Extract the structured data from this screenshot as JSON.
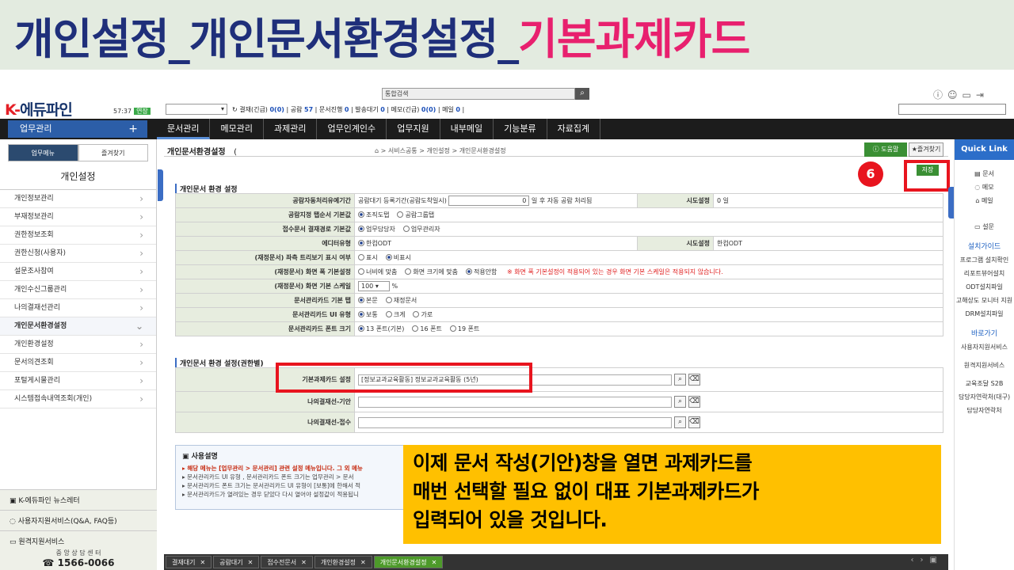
{
  "banner": {
    "title_main": "개인설정_개인문서환경설정_",
    "title_accent": "기본과제카드"
  },
  "header": {
    "logo_k": "K-",
    "logo_text": "에듀파인",
    "clock": "57:37",
    "clock_badge": "연장",
    "search_placeholder": "통합검색",
    "select_value": "▾",
    "counters": [
      {
        "label": "결재(긴급)",
        "value": "0(0)"
      },
      {
        "label": "공람",
        "value": "57"
      },
      {
        "label": "문서진행",
        "value": "0"
      },
      {
        "label": "발송대기",
        "value": "0"
      },
      {
        "label": "메모(긴급)",
        "value": "0(0)"
      },
      {
        "label": "메일",
        "value": "0"
      }
    ]
  },
  "nav": {
    "left_label": "업무관리",
    "items": [
      "문서관리",
      "메모관리",
      "과제관리",
      "업무인계인수",
      "업무지원",
      "내부메일",
      "기능분류",
      "자료집계"
    ]
  },
  "sidebar": {
    "tab1": "업무메뉴",
    "tab2": "즐겨찾기",
    "title": "개인설정",
    "items": [
      "개인정보관리",
      "부재정보관리",
      "권한정보조회",
      "권한신청(사용자)",
      "설문조사참여",
      "개인수신그룹관리",
      "나의결재선관리",
      "개인문서환경설정",
      "개인환경설정",
      "문서의견조회",
      "포털게시물관리",
      "시스템접속내역조회(개인)"
    ],
    "bottom": {
      "news": "K-에듀파인 뉴스레터",
      "support": "사용자지원서비스(Q&A, FAQ등)",
      "remote": "원격지원서비스",
      "center": "중 앙 상 담 센 터",
      "phone": "1566-0066"
    }
  },
  "page": {
    "title": "개인문서환경설정",
    "title_paren": "(",
    "breadcrumb": "> 서비스공통 > 개인설정 > 개인문서환경설정",
    "help": "도움말",
    "fav": "즐겨찾기",
    "save": "저장",
    "step": "6"
  },
  "section1": {
    "title": "개인문서 환경 설정",
    "r1_label": "공람자동처리유예기간",
    "r1_text": "공람대기 등록기간(공람도착일시)",
    "r1_value": "0",
    "r1_suffix": "일 후 자동 공람 처리됨",
    "r1_label2": "시도설정",
    "r1_value2": "0 일",
    "r2_label": "공람지정 탭순서 기본값",
    "r2_opts": [
      "조직도탭",
      "공람그룹탭"
    ],
    "r3_label": "접수문서 결재경로 기본값",
    "r3_opts": [
      "업무담당자",
      "업무관리자"
    ],
    "r4_label": "에디터유형",
    "r4_opt": "한컴ODT",
    "r4_label2": "시도설정",
    "r4_value2": "한컴ODT",
    "r5_label": "(재정문서) 좌측 트리보기 표시 여부",
    "r5_opts": [
      "표시",
      "비표시"
    ],
    "r6_label": "(재정문서) 화면 폭 기본설정",
    "r6_opts": [
      "너비에 맞춤",
      "화면 크기에 맞춤",
      "적용안함"
    ],
    "r6_warn": "※ 화면 폭 기본설정이 적용되어 있는 경우 화면 기본 스케일은 적용되지 않습니다.",
    "r7_label": "(재정문서) 화면 기본 스케일",
    "r7_value": "100",
    "r7_unit": "%",
    "r8_label": "문서관리카드 기본 탭",
    "r8_opts": [
      "본문",
      "재정문서"
    ],
    "r9_label": "문서관리카드 UI 유형",
    "r9_opts": [
      "보통",
      "크게",
      "가로"
    ],
    "r10_label": "문서관리카드 폰트 크기",
    "r10_opts": [
      "13 폰트(기본)",
      "16 폰트",
      "19 폰트"
    ]
  },
  "section2": {
    "title": "개인문서 환경 설정(권한별)",
    "r1_label": "기본과제카드 설정",
    "r1_value": "[정보교과교육활동] 정보교과교육활동 (5년)",
    "r2_label": "나의결재선-기안",
    "r3_label": "나의결재선-접수"
  },
  "usage": {
    "title": "사용설명",
    "lines": [
      "해당 메뉴는 [업무관리 > 문서관리] 관련 설정 메뉴입니다. 그 외 메뉴",
      "문서관리카드 UI 유형 , 문서관리카드 폰트 크기는 업무관리 > 문서",
      "문서관리카드 폰트 크기는 문서관리카드 UI 유형이 [보통]에 한해서 적",
      "문서관리카드가 열려있는 경우 닫았다 다시 열어야 설정값이 적용됩니"
    ]
  },
  "callout": {
    "l1": "이제 문서 작성(기안)창을 열면 과제카드를",
    "l2": "매번 선택할 필요 없이 대표 기본과제카드가",
    "l3": "입력되어 있을 것입니다."
  },
  "tabs": [
    "결재대기",
    "공람대기",
    "접수전문서",
    "개인환경설정",
    "개인문서환경설정"
  ],
  "quicklink": {
    "title": "Quick Link",
    "items": [
      "문서",
      "메모",
      "메일",
      "설문"
    ],
    "install_title": "설치가이드",
    "install": [
      "프로그램 설치확인",
      "리포트뷰어설치",
      "ODT설치파일",
      "고해상도 모니터 지원",
      "DRM설치파일"
    ],
    "go_title": "바로가기",
    "go": [
      "사용자지원서비스",
      "원격지원서비스",
      "교육조달 S2B",
      "담당자연락처(대구)",
      "담당자연락처"
    ]
  },
  "colors": {
    "accent": "#e8206e",
    "brand": "#1f2f7a",
    "callout": "#ffc000",
    "highlight": "#e8141e"
  }
}
